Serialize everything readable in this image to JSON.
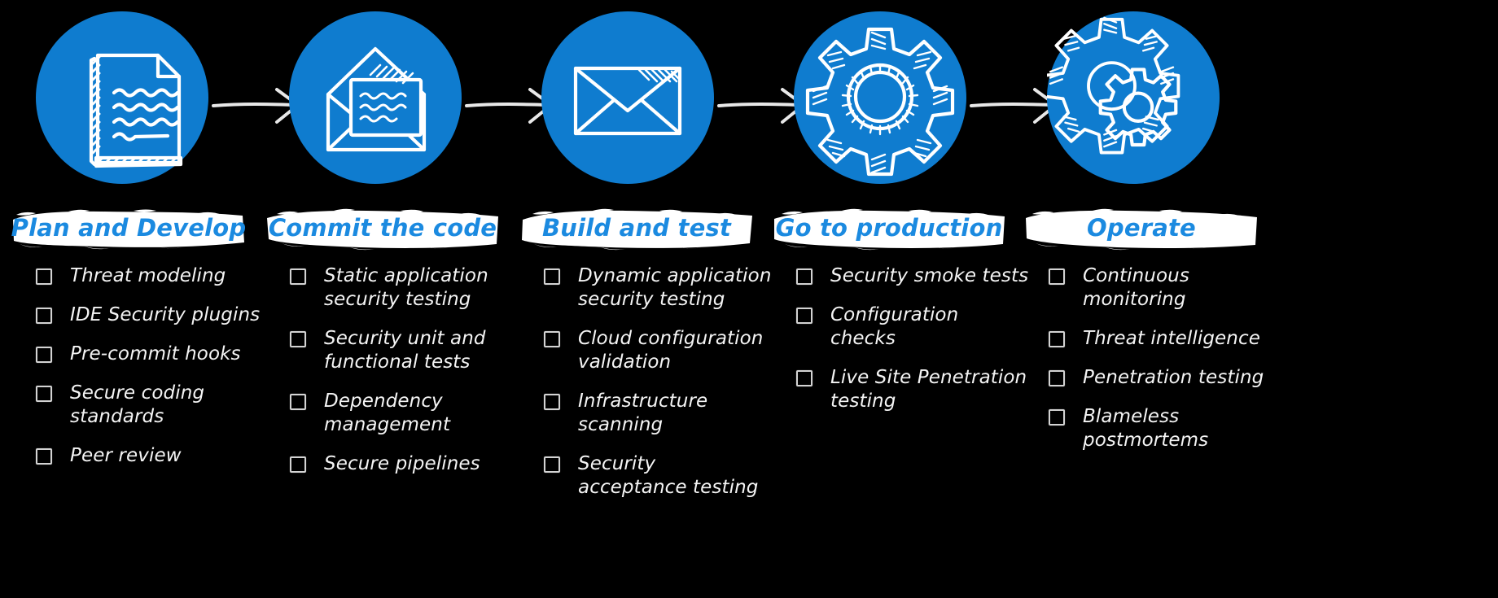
{
  "theme": {
    "background": "#000000",
    "accent_blue": "#0f7ccf",
    "title_blue": "#1b8ae0",
    "text_white": "#f4f4f4",
    "banner_white": "#ffffff"
  },
  "diagram": {
    "type": "process-flow-checklist",
    "stage_count": 5,
    "connector": "arrow-right"
  },
  "stages": [
    {
      "title": "Plan and Develop",
      "icon": "document-icon",
      "items": [
        "Threat modeling",
        "IDE Security plugins",
        "Pre-commit hooks",
        "Secure coding\nstandards",
        "Peer review"
      ]
    },
    {
      "title": "Commit the code",
      "icon": "open-envelope-icon",
      "items": [
        "Static application\nsecurity testing",
        "Security unit and\nfunctional tests",
        "Dependency\nmanagement",
        "Secure pipelines"
      ]
    },
    {
      "title": "Build and test",
      "icon": "closed-envelope-icon",
      "items": [
        "Dynamic application\nsecurity testing",
        "Cloud configuration\nvalidation",
        "Infrastructure\nscanning",
        "Security\nacceptance testing"
      ]
    },
    {
      "title": "Go to production",
      "icon": "gear-icon",
      "items": [
        "Security smoke tests",
        "Configuration checks",
        "Live Site Penetration\ntesting"
      ]
    },
    {
      "title": "Operate",
      "icon": "double-gear-icon",
      "items": [
        "Continuous\nmonitoring",
        "Threat intelligence",
        "Penetration testing",
        "Blameless\npostmortems"
      ]
    }
  ]
}
